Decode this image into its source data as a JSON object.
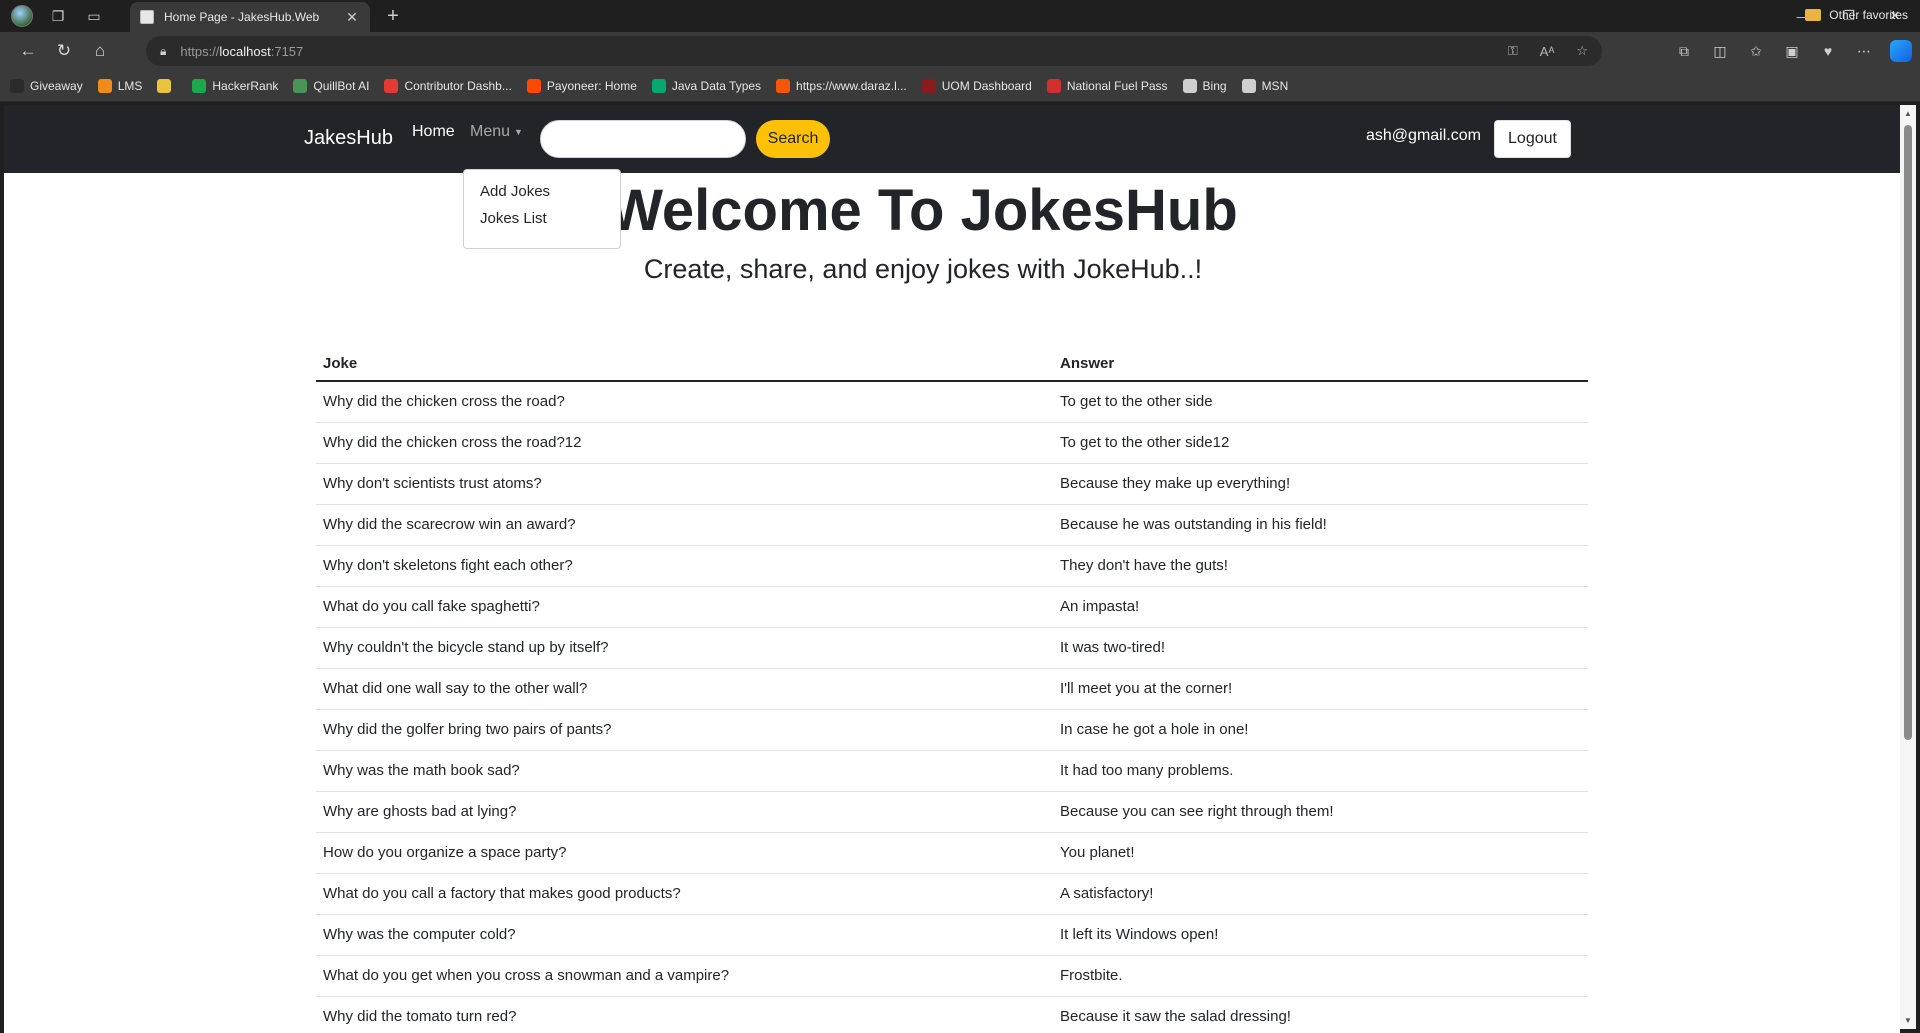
{
  "browser": {
    "tab_title": "Home Page - JakesHub.Web",
    "url_protocol": "https://",
    "url_host": "localhost",
    "url_port": ":7157",
    "bookmarks": [
      {
        "label": "Giveaway",
        "color": "#2b2b2b"
      },
      {
        "label": "LMS",
        "color": "#f08c1a"
      },
      {
        "label": "",
        "color": "#e8c53a"
      },
      {
        "label": "HackerRank",
        "color": "#1ba94c"
      },
      {
        "label": "QuillBot AI",
        "color": "#499557"
      },
      {
        "label": "Contributor Dashb...",
        "color": "#e53935"
      },
      {
        "label": "Payoneer: Home",
        "color": "#ff4800"
      },
      {
        "label": "Java Data Types",
        "color": "#04aa6d"
      },
      {
        "label": "https://www.daraz.l...",
        "color": "#f85606"
      },
      {
        "label": "UOM Dashboard",
        "color": "#8b1a1a"
      },
      {
        "label": "National Fuel Pass",
        "color": "#d32f2f"
      },
      {
        "label": "Bing",
        "color": "#cfcfcf"
      },
      {
        "label": "MSN",
        "color": "#cfcfcf"
      }
    ],
    "other_favorites": "Other favorites"
  },
  "navbar": {
    "brand": "JakesHub",
    "home": "Home",
    "menu": "Menu",
    "search_placeholder": "",
    "search_button": "Search",
    "user_email": "ash@gmail.com",
    "logout": "Logout",
    "accent_color": "#ffc107",
    "background": "#212529"
  },
  "dropdown": {
    "items": [
      "Add Jokes",
      "Jokes List"
    ]
  },
  "hero": {
    "title": "Welcome To JokesHub",
    "subtitle": "Create, share, and enjoy jokes with JokeHub..!"
  },
  "table": {
    "headers": [
      "Joke",
      "Answer"
    ],
    "rows": [
      [
        "Why did the chicken cross the road?",
        "To get to the other side"
      ],
      [
        "Why did the chicken cross the road?12",
        "To get to the other side12"
      ],
      [
        "Why don't scientists trust atoms?",
        "Because they make up everything!"
      ],
      [
        "Why did the scarecrow win an award?",
        "Because he was outstanding in his field!"
      ],
      [
        "Why don't skeletons fight each other?",
        "They don't have the guts!"
      ],
      [
        "What do you call fake spaghetti?",
        "An impasta!"
      ],
      [
        "Why couldn't the bicycle stand up by itself?",
        "It was two-tired!"
      ],
      [
        "What did one wall say to the other wall?",
        "I'll meet you at the corner!"
      ],
      [
        "Why did the golfer bring two pairs of pants?",
        "In case he got a hole in one!"
      ],
      [
        "Why was the math book sad?",
        "It had too many problems."
      ],
      [
        "Why are ghosts bad at lying?",
        "Because you can see right through them!"
      ],
      [
        "How do you organize a space party?",
        "You planet!"
      ],
      [
        "What do you call a factory that makes good products?",
        "A satisfactory!"
      ],
      [
        "Why was the computer cold?",
        "It left its Windows open!"
      ],
      [
        "What do you get when you cross a snowman and a vampire?",
        "Frostbite."
      ],
      [
        "Why did the tomato turn red?",
        "Because it saw the salad dressing!"
      ]
    ]
  }
}
